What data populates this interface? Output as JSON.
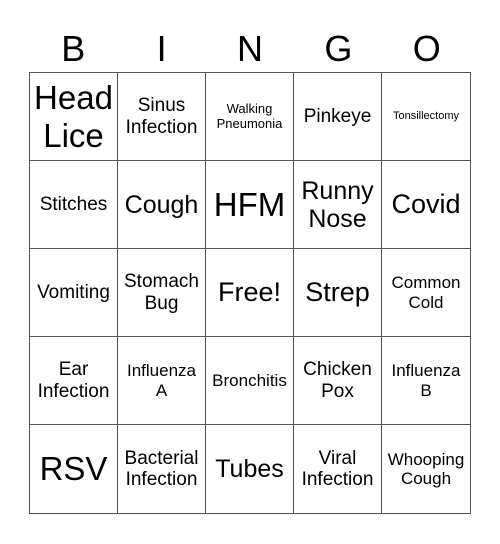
{
  "header": {
    "letters": [
      "B",
      "I",
      "N",
      "G",
      "O"
    ]
  },
  "cells": [
    [
      "Head Lice",
      "Sinus Infection",
      "Walking Pneumonia",
      "Pinkeye",
      "Tonsillectomy"
    ],
    [
      "Stitches",
      "Cough",
      "HFM",
      "Runny Nose",
      "Covid"
    ],
    [
      "Vomiting",
      "Stomach Bug",
      "Free!",
      "Strep",
      "Common Cold"
    ],
    [
      "Ear Infection",
      "Influenza A",
      "Bronchitis",
      "Chicken Pox",
      "Influenza B"
    ],
    [
      "RSV",
      "Bacterial Infection",
      "Tubes",
      "Viral Infection",
      "Whooping Cough"
    ]
  ]
}
